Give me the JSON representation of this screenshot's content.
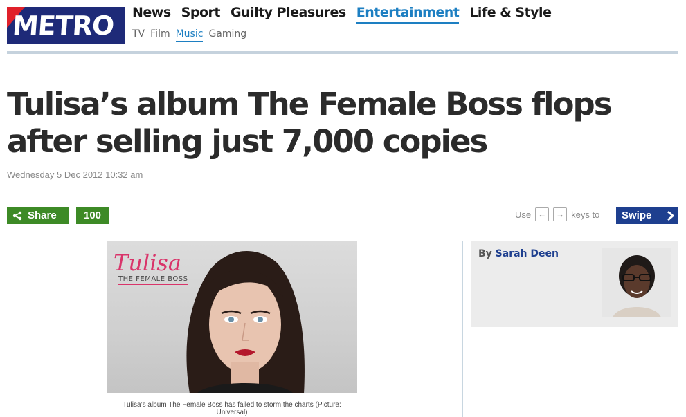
{
  "site": {
    "logo_text": "METRO"
  },
  "nav": {
    "items": [
      {
        "label": "News",
        "active": false
      },
      {
        "label": "Sport",
        "active": false
      },
      {
        "label": "Guilty Pleasures",
        "active": false
      },
      {
        "label": "Entertainment",
        "active": true
      },
      {
        "label": "Life & Style",
        "active": false
      }
    ]
  },
  "subnav": {
    "items": [
      {
        "label": "TV",
        "active": false
      },
      {
        "label": "Film",
        "active": false
      },
      {
        "label": "Music",
        "active": true
      },
      {
        "label": "Gaming",
        "active": false
      }
    ]
  },
  "article": {
    "headline": "Tulisa’s album The Female Boss flops after selling just 7,000 copies",
    "date": "Wednesday 5 Dec 2012 10:32 am",
    "image_brand": "Tulisa",
    "image_album": "THE FEMALE BOSS",
    "caption": "Tulisa’s album The Female Boss has failed to storm the charts (Picture: Universal)"
  },
  "share": {
    "label": "Share",
    "count": "100"
  },
  "keys_hint": {
    "use": "Use",
    "left_key": "←",
    "right_key": "→",
    "keys_to": "keys to",
    "swipe": "Swipe"
  },
  "author": {
    "by": "By",
    "name": "Sarah Deen"
  },
  "colors": {
    "brand_blue": "#1e2a78",
    "brand_red": "#e0202a",
    "accent": "#1d7fc2",
    "share_green": "#3d8a26",
    "swipe_blue": "#1e3f8f"
  }
}
